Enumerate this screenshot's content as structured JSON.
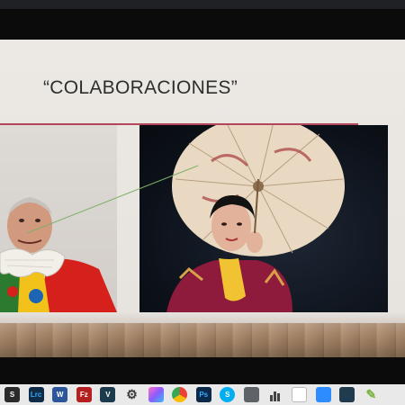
{
  "slide": {
    "title": "“COLABORACIONES”",
    "accent_color": "#b3465a",
    "photos": [
      {
        "name": "clown-photo",
        "description": "man in clown costume with large ruffled collar"
      },
      {
        "name": "parasol-photo",
        "description": "person holding paper parasol wearing kimono"
      }
    ]
  },
  "taskbar": {
    "icons": [
      {
        "name": "store-icon",
        "glyph": "🛍",
        "color": "#2b2b2b"
      },
      {
        "name": "lightroom-classic-icon",
        "glyph": "Lrc",
        "color": "#0f2b45"
      },
      {
        "name": "word-icon",
        "glyph": "W",
        "color": "#2b579a"
      },
      {
        "name": "filezilla-icon",
        "glyph": "Fz",
        "color": "#b51f1f"
      },
      {
        "name": "v-app-icon",
        "glyph": "V",
        "color": "#1b3a4b"
      },
      {
        "name": "settings-gear-icon",
        "glyph": "⚙",
        "color": "#3b3b3b"
      },
      {
        "name": "paint-app-icon",
        "glyph": "■",
        "color": "#d946ef"
      },
      {
        "name": "chrome-icon",
        "glyph": "●",
        "color": "#ea4335"
      },
      {
        "name": "photoshop-icon",
        "glyph": "Ps",
        "color": "#0b2a4a"
      },
      {
        "name": "skype-icon",
        "glyph": "S",
        "color": "#00aff0"
      },
      {
        "name": "camera-icon",
        "glyph": "📷",
        "color": "#5f6368"
      },
      {
        "name": "chart-app-icon",
        "glyph": "▐",
        "color": "#4a4a4a"
      },
      {
        "name": "document-icon",
        "glyph": "□",
        "color": "#ffffff"
      },
      {
        "name": "zoom-icon",
        "glyph": "■",
        "color": "#2d8cff"
      },
      {
        "name": "screen-share-icon",
        "glyph": "▣",
        "color": "#1f3b4d"
      },
      {
        "name": "brush-app-icon",
        "glyph": "✎",
        "color": "#7cb342"
      }
    ]
  }
}
